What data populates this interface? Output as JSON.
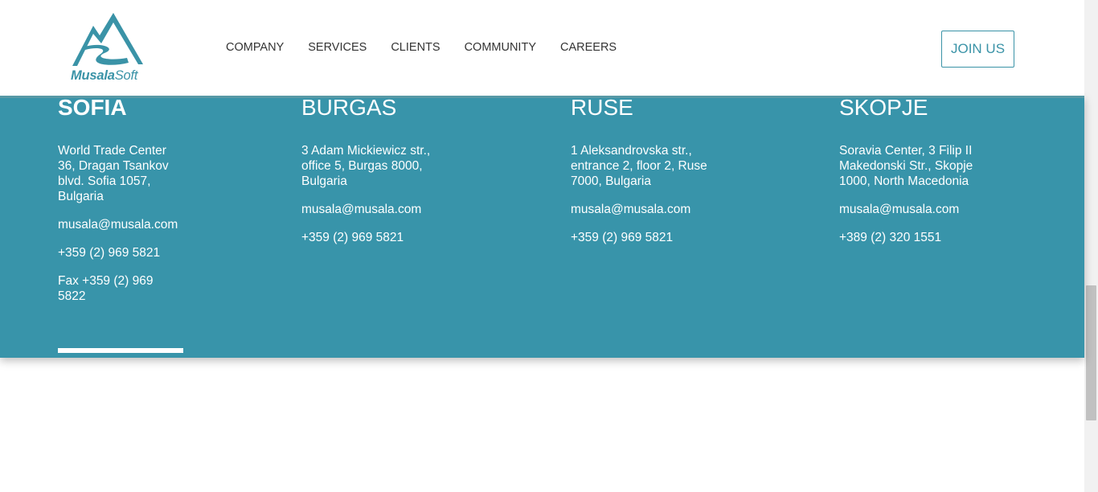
{
  "header": {
    "logo": {
      "brand_bold": "Musala",
      "brand_light": "Soft"
    },
    "nav": [
      "COMPANY",
      "SERVICES",
      "CLIENTS",
      "COMMUNITY",
      "CAREERS"
    ],
    "join_label": "JOIN US"
  },
  "offices": [
    {
      "name": "SOFIA",
      "address": "World Trade Center 36, Dragan Tsankov blvd. Sofia 1057, Bulgaria",
      "email": "musala@musala.com",
      "phone": "+359 (2) 969 5821",
      "fax": "Fax +359 (2) 969 5822",
      "selected": true
    },
    {
      "name": "BURGAS",
      "address": "3 Adam Mickiewicz str., office 5, Burgas 8000, Bulgaria",
      "email": "musala@musala.com",
      "phone": "+359 (2) 969 5821"
    },
    {
      "name": "RUSE",
      "address": "1 Aleksandrovska str., entrance 2, floor 2, Ruse 7000, Bulgaria",
      "email": "musala@musala.com",
      "phone": "+359 (2) 969 5821"
    },
    {
      "name": "SKOPJE",
      "address": "Soravia Center, 3 Filip II Makedonski Str., Skopje 1000, North Macedonia",
      "email": "musala@musala.com",
      "phone": "+389 (2) 320 1551"
    }
  ],
  "colors": {
    "accent": "#3894aa",
    "brand": "#3a93a7",
    "nav_text": "#333333"
  }
}
